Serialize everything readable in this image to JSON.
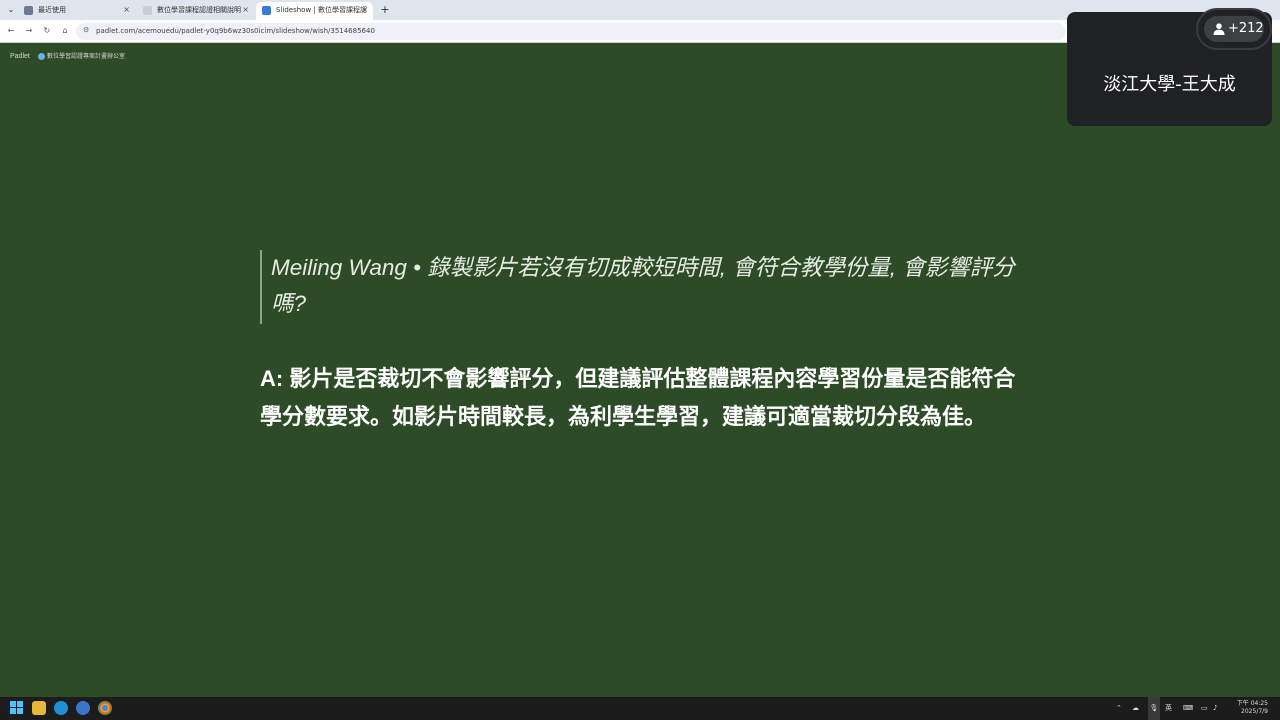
{
  "browser": {
    "tabs": [
      {
        "title": "最近使用",
        "favicon_color": "#6b7a90",
        "active": false
      },
      {
        "title": "數位學習課程認證相關說明",
        "favicon_color": "#c9ced6",
        "active": false
      },
      {
        "title": "Slideshow | 數位學習課程認",
        "favicon_color": "#3b7bd6",
        "active": true
      }
    ],
    "tab_close": "×",
    "new_tab": "+",
    "url": "padlet.com/acemouedu/padlet-y0q9b6wz30s0icim/slideshow/wish/3514685640"
  },
  "padlet": {
    "logo": "Padlet",
    "author": "數位學習認證專案計畫辦公室"
  },
  "slide": {
    "question": "Meiling Wang • 錄製影片若沒有切成較短時間, 會符合教學份量, 會影響評分嗎?",
    "answer": "A: 影片是否裁切不會影響評分，但建議評估整體課程內容學習份量是否能符合學分數要求。如影片時間較長，為利學生學習，建議可適當裁切分段為佳。"
  },
  "meeting": {
    "participant_name": "淡江大學-王大成",
    "participant_count": "+212"
  },
  "taskbar": {
    "tray_lang": "英",
    "clock_time": "下午 04:25",
    "clock_date": "2025/7/9"
  },
  "colors": {
    "slide_background": "#2e4b27",
    "meeting_panel": "#202124"
  }
}
